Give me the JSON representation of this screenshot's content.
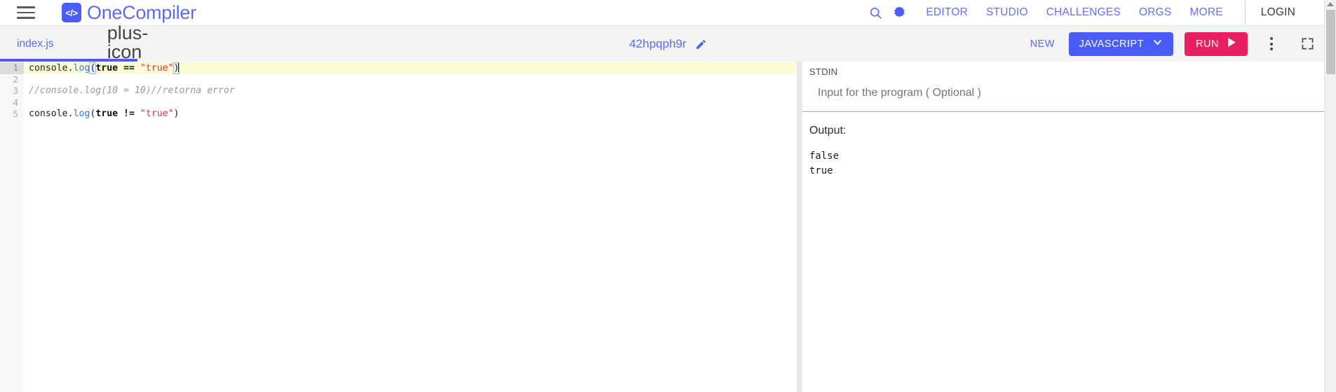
{
  "navbar": {
    "menu_icon": "hamburger-menu-icon",
    "logo_text": "</>",
    "brand": "OneCompiler",
    "search_icon": "search-icon",
    "theme_icon": "dark-mode-toggle-icon",
    "links": [
      {
        "label": "EDITOR"
      },
      {
        "label": "STUDIO"
      },
      {
        "label": "CHALLENGES"
      },
      {
        "label": "ORGS"
      },
      {
        "label": "MORE"
      }
    ],
    "login": "LOGIN"
  },
  "toolbar": {
    "file_tab": "index.js",
    "add_tab_icon": "plus-icon",
    "project_name": "42hpqph9r",
    "edit_icon": "pencil-icon",
    "new_label": "NEW",
    "language": "JAVASCRIPT",
    "language_caret": "chevron-down-icon",
    "run_label": "RUN",
    "run_icon": "play-icon",
    "kebab_icon": "more-vertical-icon",
    "fullscreen_icon": "fullscreen-icon"
  },
  "editor": {
    "line_numbers": [
      "1",
      "2",
      "3",
      "4",
      "5"
    ],
    "lines": [
      {
        "active": true,
        "tokens": [
          {
            "t": "console",
            "c": "tok-obj"
          },
          {
            "t": ".",
            "c": "tok-punct"
          },
          {
            "t": "log",
            "c": "tok-fn"
          },
          {
            "t": "(",
            "c": "tok-punct bracket-match"
          },
          {
            "t": "true",
            "c": "tok-kw"
          },
          {
            "t": " ",
            "c": "tok-punct"
          },
          {
            "t": "==",
            "c": "tok-kw"
          },
          {
            "t": " ",
            "c": "tok-punct"
          },
          {
            "t": "\"true\"",
            "c": "tok-str"
          },
          {
            "t": ")",
            "c": "tok-punct bracket-match"
          }
        ],
        "caret": true
      },
      {
        "active": false,
        "tokens": []
      },
      {
        "active": false,
        "tokens": [
          {
            "t": "//console.log(10 = 10)//retorna error",
            "c": "tok-comment"
          }
        ]
      },
      {
        "active": false,
        "tokens": []
      },
      {
        "active": false,
        "tokens": [
          {
            "t": "console",
            "c": "tok-obj"
          },
          {
            "t": ".",
            "c": "tok-punct"
          },
          {
            "t": "log",
            "c": "tok-fn"
          },
          {
            "t": "(",
            "c": "tok-punct"
          },
          {
            "t": "true",
            "c": "tok-kw"
          },
          {
            "t": " ",
            "c": "tok-punct"
          },
          {
            "t": "!=",
            "c": "tok-kw"
          },
          {
            "t": " ",
            "c": "tok-punct"
          },
          {
            "t": "\"true\"",
            "c": "tok-str"
          },
          {
            "t": ")",
            "c": "tok-punct"
          }
        ]
      }
    ]
  },
  "stdin": {
    "label": "STDIN",
    "placeholder": "Input for the program ( Optional )",
    "value": ""
  },
  "output": {
    "title": "Output:",
    "lines": [
      "false",
      "true"
    ]
  },
  "colors": {
    "brand_blue": "#5c6bf2",
    "button_blue": "#4a5df9",
    "run_pink": "#e91e63",
    "stdin_green": "#7cc47f",
    "active_line_yellow": "#fdfbd5",
    "string_red": "#e0334c"
  }
}
